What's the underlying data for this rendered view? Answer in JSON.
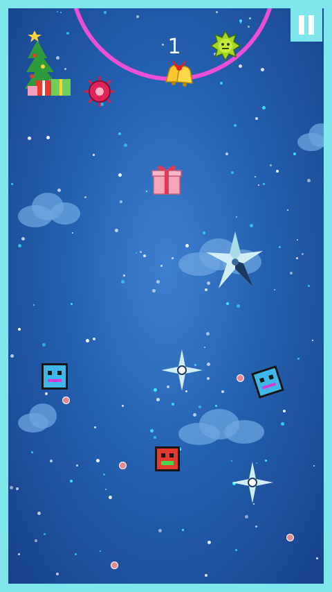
{
  "hud": {
    "score": "1"
  },
  "colors": {
    "frame": "#7fe6ec",
    "ring": "#ec4fd6",
    "background": "#2460b0",
    "player_cube": "#e23a2e",
    "enemy_cube": "#3fb7e8"
  },
  "icons": {
    "pause": "pause-icon",
    "tree": "christmas-tree-icon",
    "bells": "bells-icon",
    "virus_green": "green-virus-icon",
    "virus_red": "red-virus-icon",
    "gift": "gift-box-icon",
    "shuriken": "shuriken-icon"
  }
}
